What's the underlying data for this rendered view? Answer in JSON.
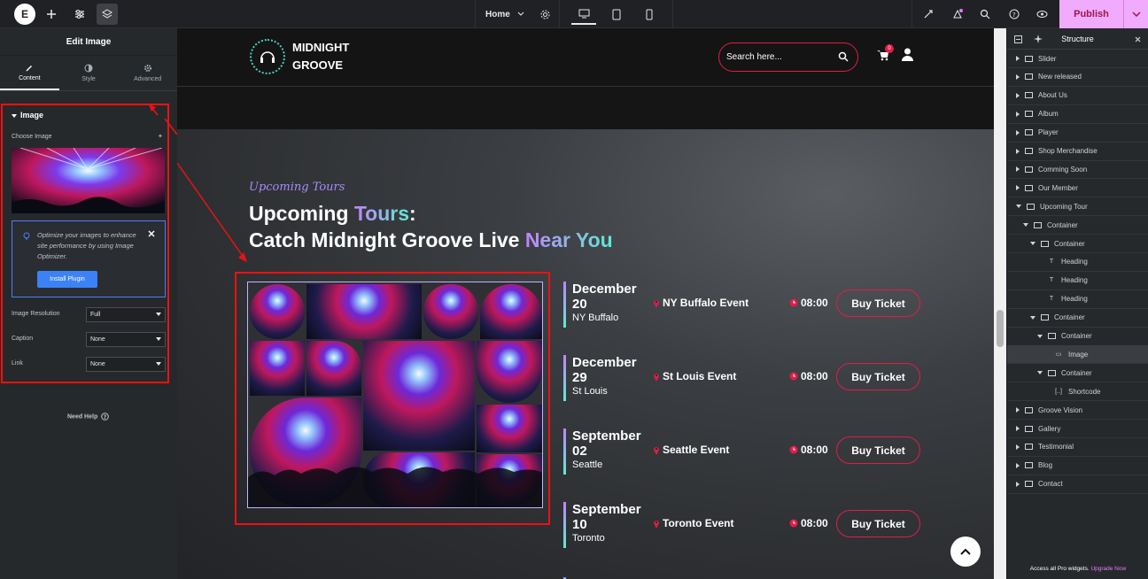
{
  "topbar": {
    "logo": "E",
    "page_select": "Home",
    "publish_label": "Publish"
  },
  "left_panel": {
    "title": "Edit Image",
    "tabs": [
      {
        "label": "Content",
        "icon": "pencil-icon"
      },
      {
        "label": "Style",
        "icon": "half-circle-icon"
      },
      {
        "label": "Advanced",
        "icon": "gear-icon"
      }
    ],
    "section": "Image",
    "choose_image_label": "Choose Image",
    "optimizer_text": "Optimize your images to enhance site performance by using Image Optimizer.",
    "install_label": "Install Plugin",
    "resolution_label": "Image Resolution",
    "resolution_value": "Full",
    "caption_label": "Caption",
    "caption_value": "None",
    "link_label": "Link",
    "link_value": "None",
    "need_help": "Need Help"
  },
  "site": {
    "brand_line1": "MIDNIGHT",
    "brand_line2": "GROOVE",
    "search_placeholder": "Search here...",
    "cart_count": "0",
    "script_title": "Upcoming Tours",
    "heading1_a": "Upcoming ",
    "heading1_b": "Tours",
    "heading1_c": ":",
    "heading2_a": "Catch Midnight Groove Live ",
    "heading2_b": "Near You",
    "events": [
      {
        "month": "December",
        "day": "20",
        "city": "NY Buffalo",
        "name": "NY Buffalo Event",
        "time": "08:00",
        "button": "Buy Ticket"
      },
      {
        "month": "December",
        "day": "29",
        "city": "St Louis",
        "name": "St Louis Event",
        "time": "08:00",
        "button": "Buy Ticket"
      },
      {
        "month": "September",
        "day": "02",
        "city": "Seattle",
        "name": "Seattle Event",
        "time": "08:00",
        "button": "Buy Ticket"
      },
      {
        "month": "September",
        "day": "10",
        "city": "Toronto",
        "name": "Toronto Event",
        "time": "08:00",
        "button": "Buy Ticket"
      }
    ]
  },
  "right_panel": {
    "title": "Structure",
    "tree": [
      {
        "label": "Slider",
        "arrow": "r",
        "indent": 0
      },
      {
        "label": "New released",
        "arrow": "r",
        "indent": 0
      },
      {
        "label": "About Us",
        "arrow": "r",
        "indent": 0
      },
      {
        "label": "Album",
        "arrow": "r",
        "indent": 0
      },
      {
        "label": "Player",
        "arrow": "r",
        "indent": 0
      },
      {
        "label": "Shop Merchandise",
        "arrow": "r",
        "indent": 0
      },
      {
        "label": "Comming Soon",
        "arrow": "r",
        "indent": 0
      },
      {
        "label": "Our Member",
        "arrow": "r",
        "indent": 0
      },
      {
        "label": "Upcoming Tour",
        "arrow": "d",
        "indent": 0
      },
      {
        "label": "Container",
        "arrow": "d",
        "indent": 1
      },
      {
        "label": "Container",
        "arrow": "d",
        "indent": 2
      },
      {
        "label": "Heading",
        "arrow": "n",
        "indent": 3,
        "icon": "T"
      },
      {
        "label": "Heading",
        "arrow": "n",
        "indent": 3,
        "icon": "T"
      },
      {
        "label": "Heading",
        "arrow": "n",
        "indent": 3,
        "icon": "T"
      },
      {
        "label": "Container",
        "arrow": "d",
        "indent": 2
      },
      {
        "label": "Container",
        "arrow": "d",
        "indent": 3
      },
      {
        "label": "Image",
        "arrow": "n",
        "indent": 4,
        "icon": "img",
        "selected": true
      },
      {
        "label": "Container",
        "arrow": "d",
        "indent": 3
      },
      {
        "label": "Shortcode",
        "arrow": "n",
        "indent": 4,
        "icon": "[..]"
      },
      {
        "label": "Groove Vision",
        "arrow": "r",
        "indent": 0
      },
      {
        "label": "Gallery",
        "arrow": "r",
        "indent": 0
      },
      {
        "label": "Testimonial",
        "arrow": "r",
        "indent": 0
      },
      {
        "label": "Blog",
        "arrow": "r",
        "indent": 0
      },
      {
        "label": "Contact",
        "arrow": "r",
        "indent": 0
      }
    ],
    "footer_a": "Access all Pro widgets. ",
    "footer_b": "Upgrade Now"
  }
}
